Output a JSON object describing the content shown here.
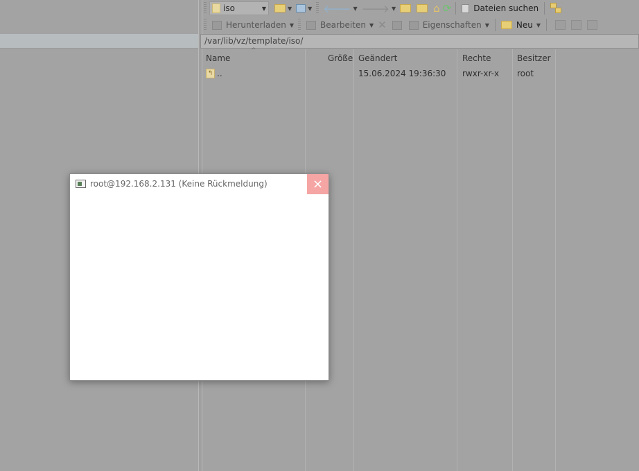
{
  "toolbar1": {
    "location_combo": "iso",
    "find_files_label": "Dateien suchen"
  },
  "toolbar2": {
    "download_label": "Herunterladen",
    "edit_label": "Bearbeiten",
    "properties_label": "Eigenschaften",
    "new_label": "Neu"
  },
  "path": "/var/lib/vz/template/iso/",
  "file_list": {
    "columns": [
      "Name",
      "Größe",
      "Geändert",
      "Rechte",
      "Besitzer"
    ],
    "rows": [
      {
        "name": "..",
        "size": "",
        "modified": "15.06.2024 19:36:30",
        "rights": "rwxr-xr-x",
        "owner": "root"
      }
    ]
  },
  "dialog": {
    "title": "root@192.168.2.131 (Keine Rückmeldung)"
  },
  "icons": {
    "close": "×",
    "parent_dir": "↰"
  }
}
